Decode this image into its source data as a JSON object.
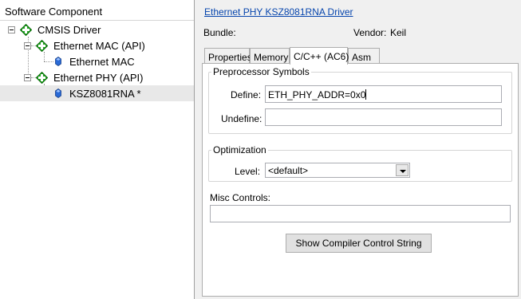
{
  "tree": {
    "header": "Software Component",
    "items": [
      {
        "label": "CMSIS Driver"
      },
      {
        "label": "Ethernet MAC (API)"
      },
      {
        "label": "Ethernet MAC"
      },
      {
        "label": "Ethernet PHY (API)"
      },
      {
        "label": "KSZ8081RNA *"
      }
    ],
    "selected_index": 4
  },
  "details": {
    "title_link": "Ethernet PHY KSZ8081RNA Driver",
    "bundle_label": "Bundle:",
    "bundle_value": "",
    "vendor_label": "Vendor:",
    "vendor_value": "Keil"
  },
  "tabs": [
    {
      "label": "Properties",
      "active": false
    },
    {
      "label": "Memory",
      "active": false
    },
    {
      "label": "C/C++ (AC6)",
      "active": true
    },
    {
      "label": "Asm",
      "active": false
    }
  ],
  "preprocessor": {
    "legend": "Preprocessor Symbols",
    "define_label": "Define:",
    "define_value": "ETH_PHY_ADDR=0x0",
    "undefine_label": "Undefine:",
    "undefine_value": ""
  },
  "optimization": {
    "legend": "Optimization",
    "level_label": "Level:",
    "level_value": "<default>"
  },
  "misc": {
    "label": "Misc Controls:",
    "value": ""
  },
  "buttons": {
    "show_compiler": "Show Compiler Control String"
  },
  "colors": {
    "component_icon": "#1fa51f",
    "sub_icon": "#2a6ad6",
    "link": "#0645ad"
  }
}
